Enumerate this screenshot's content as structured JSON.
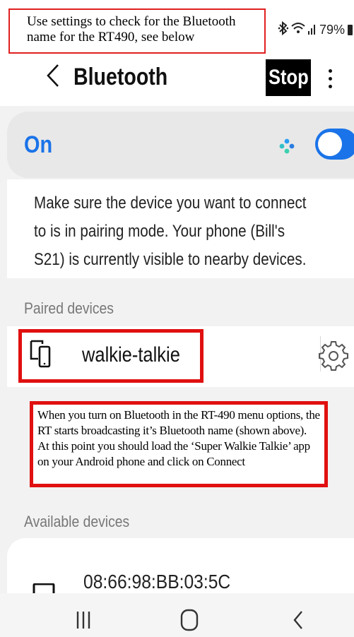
{
  "annotations": {
    "top_note": "Use settings to check for the Bluetooth name for the RT490, see below",
    "middle_note": "When you turn on Bluetooth in the RT-490 menu options, the RT starts broadcasting it’s Bluetooth name (shown above). At this point you should load the ‘Super Walkie Talkie’ app on your Android phone and click on Connect"
  },
  "status_bar": {
    "battery": "79%",
    "icons": [
      "bluetooth-icon",
      "wifi-icon",
      "signal-icon",
      "battery-icon"
    ]
  },
  "header": {
    "back_icon": "back-chevron-icon",
    "title": "Bluetooth",
    "stop_label": "Stop",
    "more_icon": "more-vertical-icon"
  },
  "bluetooth_toggle": {
    "label": "On",
    "state": "on"
  },
  "description": "Make sure the device you want to connect to is in pairing mode. Your phone (Bill's S21) is currently visible to nearby devices.",
  "paired_devices": {
    "heading": "Paired devices",
    "items": [
      {
        "name": "walkie-talkie",
        "icon": "device-icon",
        "settings_icon": "gear-icon"
      }
    ]
  },
  "available_devices": {
    "heading": "Available devices",
    "items": [
      {
        "name": "08:66:98:BB:03:5C",
        "icon": "laptop-icon"
      }
    ]
  },
  "navigation": {
    "buttons": [
      "recent-apps-icon",
      "home-icon",
      "back-icon"
    ]
  },
  "colors": {
    "accent": "#1a73e8",
    "highlight_border": "#e01010",
    "background": "#f2f2f2"
  }
}
